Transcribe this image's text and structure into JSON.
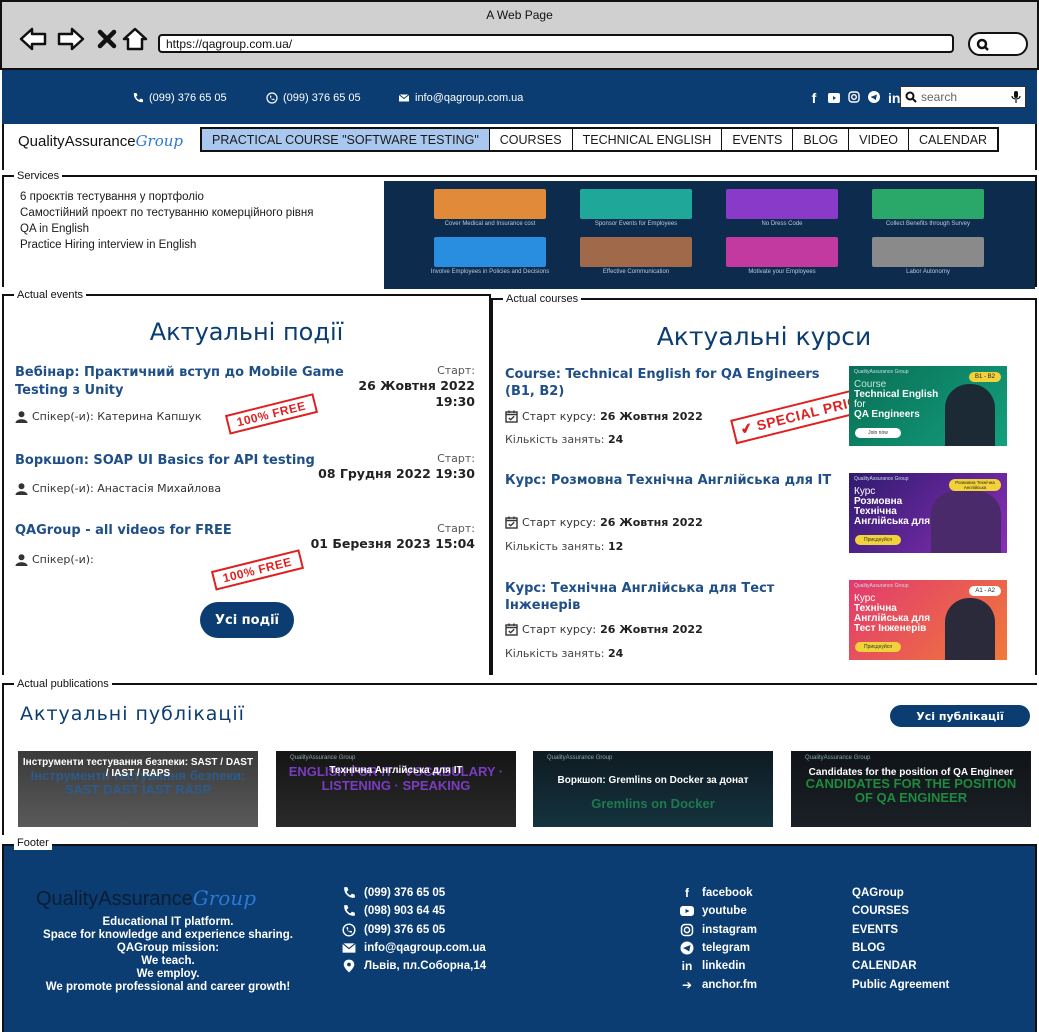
{
  "browser": {
    "title": "A Web Page",
    "url": "https://qagroup.com.ua/"
  },
  "topbar": {
    "phone_1": "(099) 376 65 05",
    "viber_1": "(099) 376 65 05",
    "email": "info@qagroup.com.ua",
    "social_icons": [
      "facebook-icon",
      "youtube-icon",
      "instagram-icon",
      "telegram-icon",
      "linkedin-icon"
    ],
    "search_placeholder": "search"
  },
  "header": {
    "logo_text": "QualityAssurance",
    "logo_script": "Group",
    "nav": [
      {
        "label": "PRACTICAL COURSE \"SOFTWARE TESTING\"",
        "active": true
      },
      {
        "label": "COURSES"
      },
      {
        "label": "TECHNICAL ENGLISH"
      },
      {
        "label": "EVENTS"
      },
      {
        "label": "BLOG"
      },
      {
        "label": "VIDEO"
      },
      {
        "label": "CALENDAR"
      }
    ]
  },
  "services": {
    "legend": "Services",
    "items": [
      "6 проєктів тестування у портфоліо",
      "Самостійний проект по тестуванню комерційного рівня",
      "QA in English",
      "Practice Hiring interview in English"
    ],
    "image_captions": [
      "Cover Medical and Insurance cost",
      "Sponsor Events for Employees",
      "No Dress Code",
      "Collect Benefits through Survey",
      "Involve Employees in Policies and Decisions",
      "Effective Communication",
      "Motivate your Employees",
      "Labor Autonomy"
    ]
  },
  "events": {
    "legend": "Actual events",
    "heading": "Актуальні події",
    "start_label": "Старт:",
    "items": [
      {
        "title_1": "Вебінар: Практичний вступ до Mobile Game",
        "title_2": "Testing з Unity",
        "date_1": "26 Жовтня 2022",
        "date_2": "19:30",
        "speaker": "Спікер(-и): Катерина Капшук",
        "stamp": "100% FREE"
      },
      {
        "title_1": "Воркшоп: SOAP UI Basics for API testing",
        "date_1": "08 Грудня 2022 19:30",
        "speaker": "Спікер(-и): Анастасія Михайлова"
      },
      {
        "title_1": "QAGroup - all videos for FREE",
        "date_1": "01 Березня 2023 15:04",
        "speaker": "Спікер(-и):",
        "stamp": "100% FREE"
      }
    ],
    "all_button": "Усі події"
  },
  "courses": {
    "legend": "Actual courses",
    "heading": "Актуальні курси",
    "start_label": "Старт курсу:",
    "count_label": "Кількість занять:",
    "stamp": "SPECIAL PRICE",
    "items": [
      {
        "title": "Course: Technical English for QA Engineers (B1, B2)",
        "date": "26 Жовтня 2022",
        "count": "24",
        "img_tag": "B1 - B2",
        "img_lines": [
          "Course",
          "Technical English",
          "for",
          "QA Engineers"
        ],
        "img_btn": "Join now",
        "img_head": "QualityAssurance Group",
        "colors": [
          "#0c8a6c",
          "#12a37f"
        ]
      },
      {
        "title": "Курс: Розмовна Технічна Англійська для IT",
        "date": "26 Жовтня 2022",
        "count": "12",
        "img_tag": "Розмовна Технічна Англійська",
        "img_lines": [
          "Курс",
          "Розмовна",
          "Технічна",
          "Англійська для IT"
        ],
        "img_btn": "Приєднуйся",
        "img_head": "QualityAssurance Group",
        "colors": [
          "#3a1f7a",
          "#8b2fb6"
        ]
      },
      {
        "title": "Курс: Технічна Англійська для Тест Інженерів",
        "date": "26 Жовтня 2022",
        "count": "24",
        "img_tag": "A1 - A2",
        "img_lines": [
          "Курс",
          "Технічна",
          "Англійська для",
          "Тест Інженерів"
        ],
        "img_btn": "Приєднуйся",
        "img_head": "QualityAssurance Group",
        "colors": [
          "#e23a6e",
          "#f27a3a"
        ]
      }
    ]
  },
  "publications": {
    "legend": "Actual publications",
    "heading": "Актуальні публікації",
    "all_button": "Усі публікації",
    "items": [
      {
        "text": "Інструменти тестування безпеки: SAST / DAST / IAST / RAPS",
        "bg_text": "Інструменти тестування безпеки: SAST DAST IAST RASP",
        "head": "",
        "colors": [
          "#3a3a3a",
          "#5a5a5a"
        ],
        "bg_color": "#2d5b8a"
      },
      {
        "text": "Технічна Англійська для IT",
        "bg_text": "ENGLISH FOR IT · VOCABULARY · LISTENING · SPEAKING",
        "head": "QualityAssurance Group",
        "colors": [
          "#151515",
          "#2a2a2a"
        ],
        "bg_color": "#7a3cc0"
      },
      {
        "text": "Воркшоп: Gremlins on Docker за донат",
        "bg_text": "Gremlins on Docker",
        "head": "QualityAssurance Group",
        "colors": [
          "#0f1a22",
          "#14333e"
        ],
        "bg_color": "#1e7a4e"
      },
      {
        "text": "Candidates for the position of QA Engineer",
        "bg_text": "CANDIDATES FOR THE POSITION OF QA ENGINEER",
        "head": "QualityAssurance Group",
        "colors": [
          "#101418",
          "#1a2026"
        ],
        "bg_color": "#1e8a3e"
      }
    ]
  },
  "footer": {
    "legend": "Footer",
    "logo_text": "QualityAssurance",
    "logo_script": "Group",
    "about": [
      "Educational IT platform.",
      "Space for knowledge and experience sharing.",
      "QAGroup mission:",
      "We teach.",
      "We employ.",
      "We promote professional and career growth!"
    ],
    "contacts": [
      {
        "icon": "phone-icon",
        "text": "(099) 376 65 05"
      },
      {
        "icon": "phone-icon",
        "text": "(098) 903 64 45"
      },
      {
        "icon": "viber-icon",
        "text": "(099) 376 65 05"
      },
      {
        "icon": "email-icon",
        "text": "info@qagroup.com.ua"
      },
      {
        "icon": "location-icon",
        "text": "Львів, пл.Соборна,14"
      }
    ],
    "social": [
      {
        "icon": "facebook-icon",
        "text": "facebook"
      },
      {
        "icon": "youtube-icon",
        "text": "youtube"
      },
      {
        "icon": "instagram-icon",
        "text": "instagram"
      },
      {
        "icon": "telegram-icon",
        "text": "telegram"
      },
      {
        "icon": "linkedin-icon",
        "text": "linkedin"
      },
      {
        "icon": "anchor-icon",
        "text": "anchor.fm"
      }
    ],
    "links": [
      "QAGroup",
      "COURSES",
      "EVENTS",
      "BLOG",
      "CALENDAR",
      "Public Agreement"
    ]
  },
  "colors": {
    "primary": "#0b3d72",
    "link": "#1f4f86",
    "nav_active": "#a9c7ef",
    "stamp": "#e02020"
  }
}
